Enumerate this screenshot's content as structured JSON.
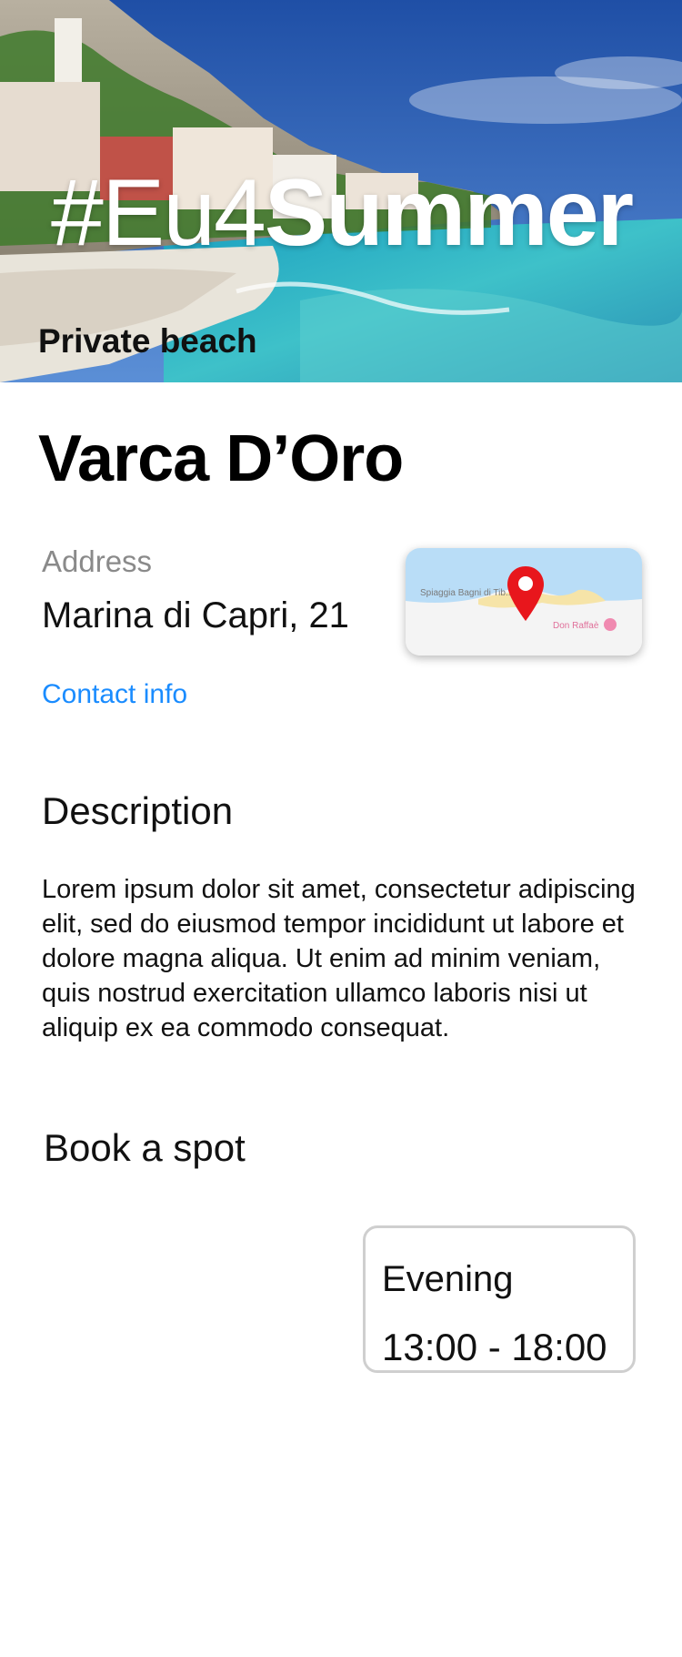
{
  "hero": {
    "hashtag_prefix": "#Eu4",
    "hashtag_emphasis": "Summer",
    "category": "Private beach"
  },
  "place": {
    "name": "Varca D’Oro",
    "address_label": "Address",
    "address": "Marina di Capri, 21",
    "contact_link": "Contact info"
  },
  "map": {
    "label_left": "Spiaggia Bagni di Tib...",
    "label_right": "Don Raffaè",
    "pin_color": "#e8161c",
    "icon": "map-pin-icon"
  },
  "description": {
    "title": "Description",
    "body": "Lorem ipsum dolor sit amet, consectetur adipiscing elit, sed do eiusmod tempor incididunt ut labore et dolore magna aliqua. Ut enim ad minim veniam, quis nostrud exercitation ullamco laboris nisi ut aliquip ex ea commodo consequat."
  },
  "booking": {
    "title": "Book a spot",
    "slots": [
      {
        "name": "Evening",
        "time": "13:00 - 18:00"
      }
    ]
  },
  "colors": {
    "link": "#1a8cff",
    "card_border": "#cfcfcf",
    "muted_text": "#8a8a8a"
  }
}
